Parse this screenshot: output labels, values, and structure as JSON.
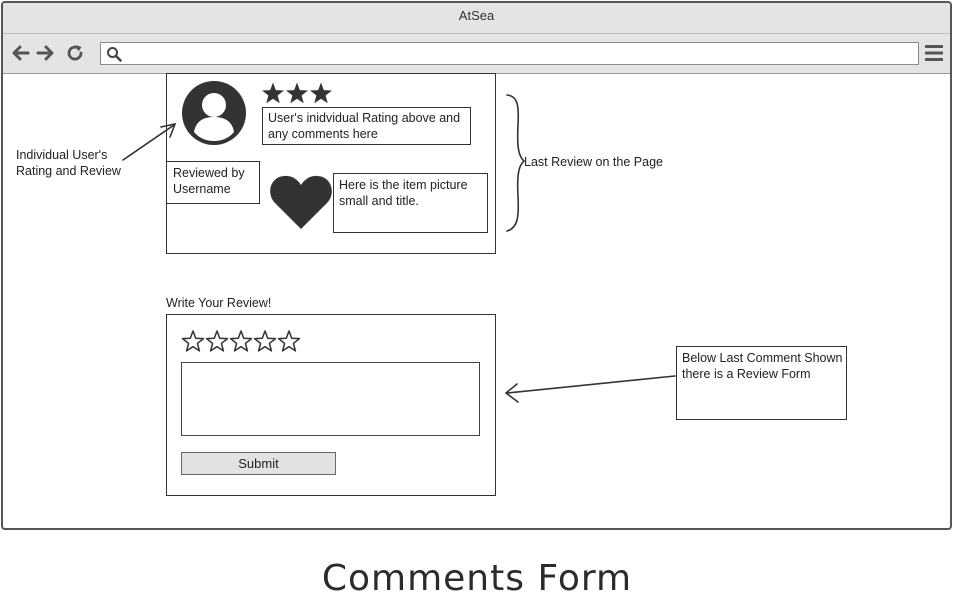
{
  "window": {
    "title": "AtSea"
  },
  "toolbar": {
    "search_value": "",
    "icons": [
      "back-arrow-icon",
      "forward-arrow-icon",
      "reload-icon",
      "search-icon",
      "hamburger-menu-icon"
    ]
  },
  "last_review": {
    "rating_stars": 3,
    "rating_max": 5,
    "comment_placeholder": "User's  inidvidual Rating above and any comments here",
    "reviewed_by": "Reviewed by Username",
    "item_description": "Here is the item picture small and title.",
    "icons": [
      "user-avatar-icon",
      "heart-icon"
    ]
  },
  "annotations": {
    "individual_review": "Individual User's Rating and Review",
    "last_review": "Last Review on the Page",
    "below_last_comment": "Below Last Comment Shown there is a Review Form"
  },
  "review_form": {
    "heading": "Write Your Review!",
    "star_count": 5,
    "textarea_value": "",
    "submit_label": "Submit"
  },
  "caption": "Comments Form"
}
